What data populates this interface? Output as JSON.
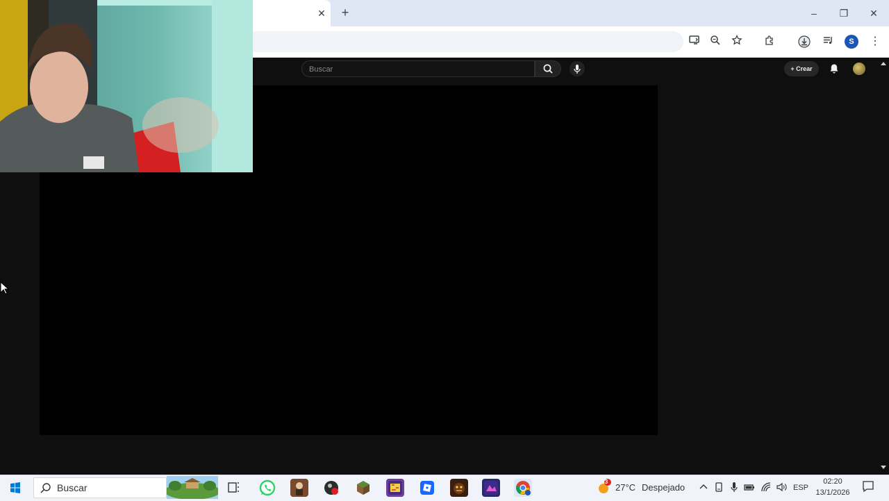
{
  "browser": {
    "tab_close": "✕",
    "new_tab": "+",
    "window_controls": {
      "minimize": "–",
      "restore": "❐",
      "close": "✕"
    },
    "toolbar_icons": [
      "install-app-icon",
      "zoom-icon",
      "bookmark-star-icon",
      "extensions-icon",
      "download-icon",
      "media-control-icon"
    ],
    "profile_initial": "S",
    "menu": "⋮"
  },
  "youtube": {
    "search_placeholder": "Buscar",
    "create_label": "+ Crear",
    "colors": {
      "background": "#0f0f0f",
      "player": "#000000"
    }
  },
  "taskbar": {
    "search_label": "Buscar",
    "apps": [
      "task-view",
      "whatsapp",
      "game-app-1",
      "game-app-2",
      "minecraft",
      "game-app-3",
      "roblox",
      "fnaf",
      "game-app-4",
      "chrome"
    ],
    "weather": {
      "badge": "3",
      "temp": "27°C",
      "desc": "Despejado"
    },
    "lang": "ESP",
    "time": "02:20",
    "date": "13/1/2026"
  }
}
